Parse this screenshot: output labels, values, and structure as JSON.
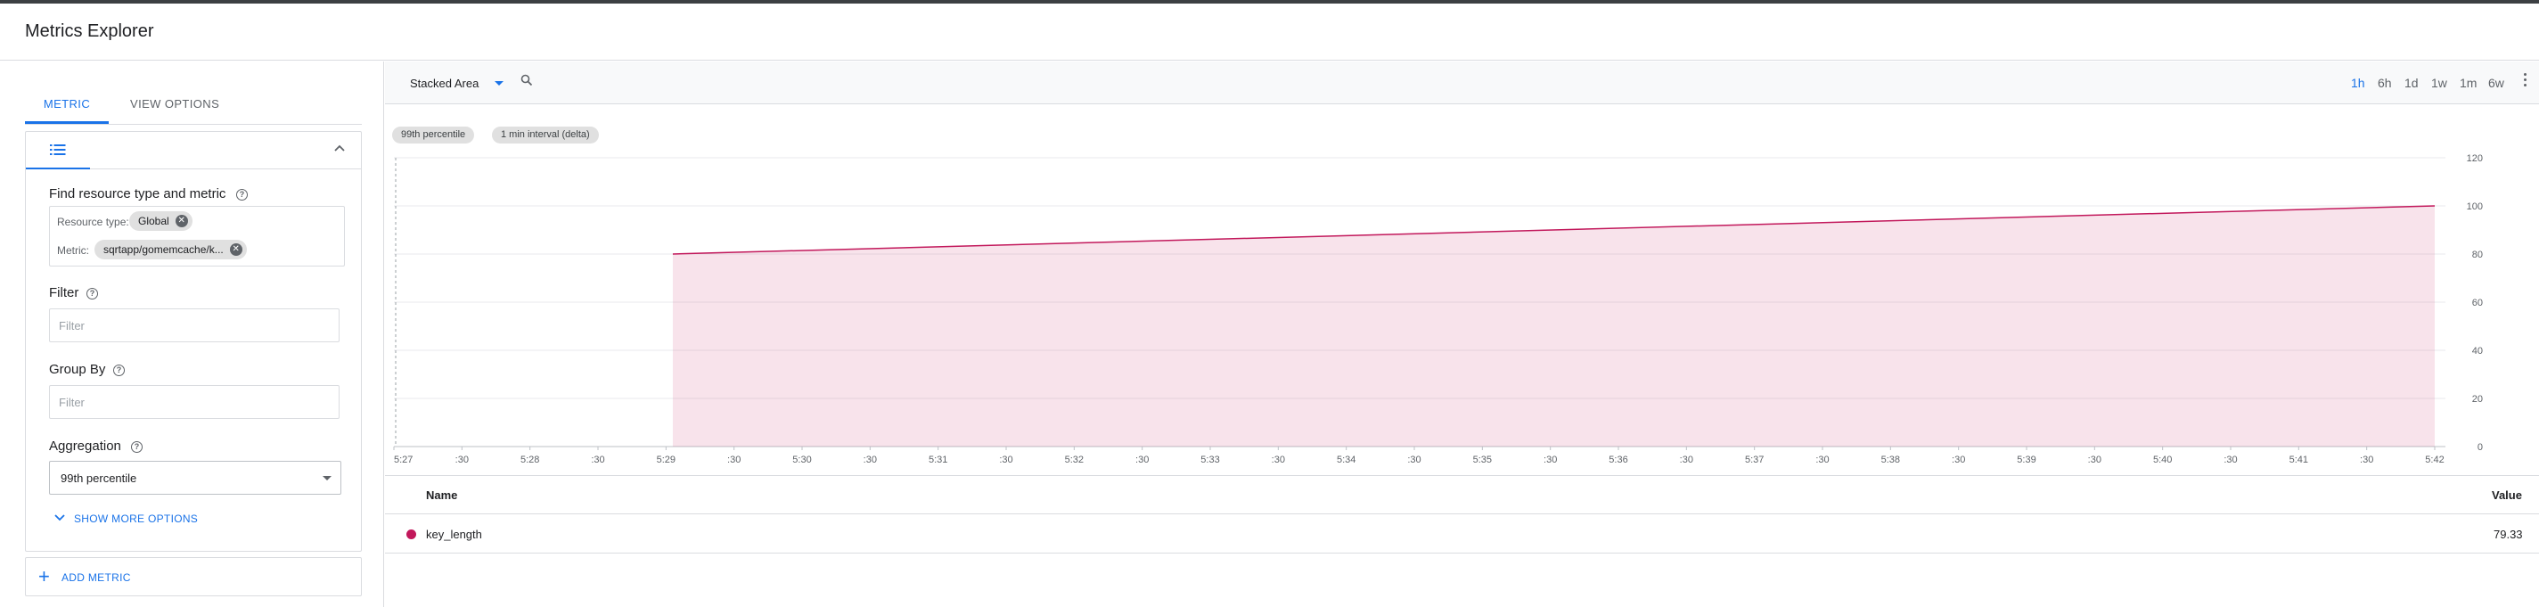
{
  "header": {
    "title": "Metrics Explorer"
  },
  "left": {
    "tabs": {
      "metric": "METRIC",
      "view_options": "VIEW OPTIONS"
    },
    "find_label": "Find resource type and metric",
    "resource_type_label": "Resource type:",
    "resource_type_value": "Global",
    "metric_label": "Metric:",
    "metric_value": "sqrtapp/gomemcache/k...",
    "filter_label": "Filter",
    "filter_placeholder": "Filter",
    "group_by_label": "Group By",
    "group_by_placeholder": "Filter",
    "aggregation_label": "Aggregation",
    "aggregation_value": "99th percentile",
    "show_more": "SHOW MORE OPTIONS",
    "add_metric": "ADD METRIC"
  },
  "toolbar": {
    "chart_type": "Stacked Area",
    "ranges": [
      "1h",
      "6h",
      "1d",
      "1w",
      "1m",
      "6w"
    ],
    "active_range": "1h"
  },
  "chips": {
    "percentile": "99th percentile",
    "interval": "1 min interval (delta)"
  },
  "table": {
    "headers": {
      "name": "Name",
      "value": "Value"
    },
    "rows": [
      {
        "name": "key_length",
        "value": "79.33"
      }
    ]
  },
  "colors": {
    "series": "#c2185b",
    "accent": "#1a73e8"
  },
  "chart_data": {
    "type": "area",
    "x_ticks": [
      "5:27",
      ":30",
      "5:28",
      ":30",
      "5:29",
      ":30",
      "5:30",
      ":30",
      "5:31",
      ":30",
      "5:32",
      ":30",
      "5:33",
      ":30",
      "5:34",
      ":30",
      "5:35",
      ":30",
      "5:36",
      ":30",
      "5:37",
      ":30",
      "5:38",
      ":30",
      "5:39",
      ":30",
      "5:40",
      ":30",
      "5:41",
      ":30",
      "5:42"
    ],
    "y_ticks": [
      0,
      20,
      40,
      60,
      80,
      100,
      120
    ],
    "ylim": [
      0,
      120
    ],
    "x_range_minutes": [
      0,
      15
    ],
    "series": [
      {
        "name": "key_length",
        "x_minutes": [
          2.05,
          15.0
        ],
        "values": [
          80,
          100
        ]
      }
    ],
    "grid": true,
    "y_axis_side": "right"
  }
}
